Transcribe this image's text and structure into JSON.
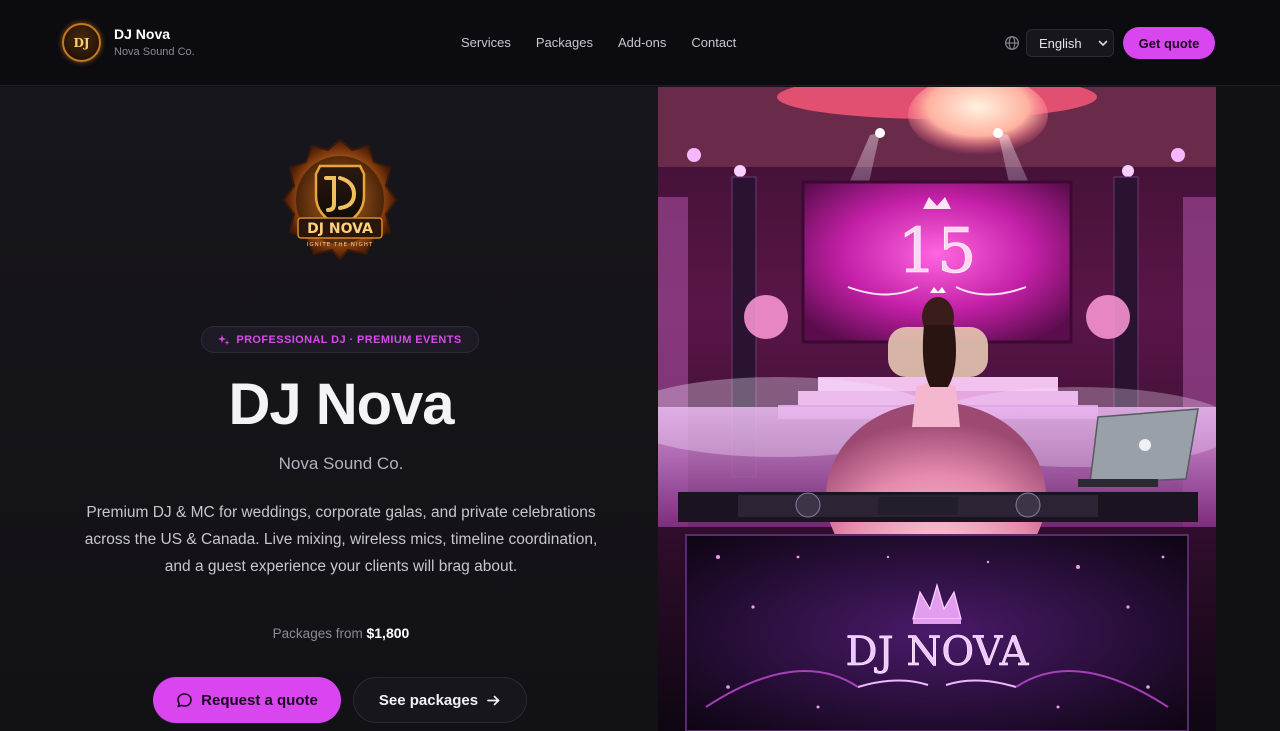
{
  "brand": {
    "name": "DJ Nova",
    "subtitle": "Nova Sound Co.",
    "logo_text": "DJ"
  },
  "nav": {
    "links": [
      "Services",
      "Packages",
      "Add-ons",
      "Contact"
    ],
    "language": "English",
    "cta_label": "Get quote"
  },
  "hero": {
    "logo_text": "DJ NOVA",
    "logo_tagline": "IGNITE THE NIGHT",
    "badge": "PROFESSIONAL DJ · PREMIUM EVENTS",
    "title": "DJ Nova",
    "subtitle": "Nova Sound Co.",
    "description": "Premium DJ & MC for weddings, corporate galas, and private celebrations across the US & Canada. Live mixing, wireless mics, timeline coordination, and a guest experience your clients will brag about.",
    "price_prefix": "Packages from",
    "price_value": "$1,800",
    "primary_button": "Request a quote",
    "secondary_button": "See packages"
  },
  "hero_image": {
    "screen_number": "15",
    "booth_text": "DJ NOVA"
  },
  "colors": {
    "accent": "#d946ef",
    "background": "#111015",
    "nav_background": "#0c0b0f"
  },
  "icons": {
    "globe": "globe-icon",
    "chevron": "chevron-down-icon",
    "sparkle": "sparkle-icon",
    "chat": "chat-bubble-icon",
    "arrow": "arrow-right-icon"
  }
}
